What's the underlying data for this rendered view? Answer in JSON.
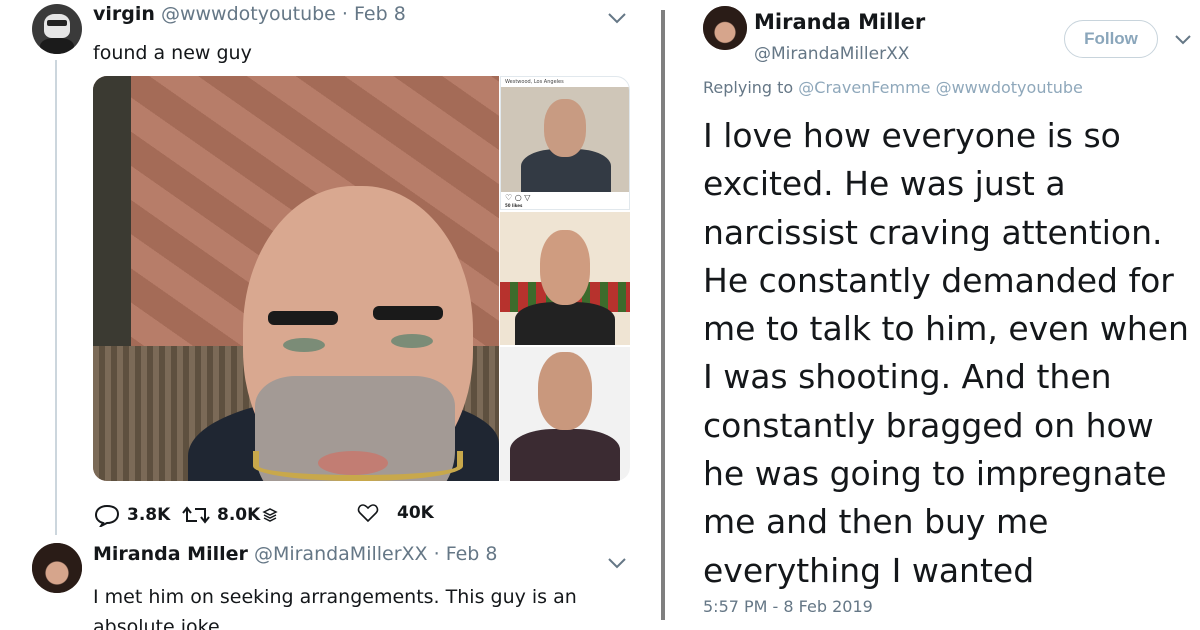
{
  "tweet1": {
    "name": "virgin",
    "handle": "@wwwdotyoutube",
    "date": "Feb 8",
    "text": "found a new guy",
    "image_a": {
      "location": "Westwood, Los Angeles",
      "likes": "50 likes"
    },
    "actions": {
      "replies": "3.8K",
      "retweets": "8.0K",
      "likes": "40K"
    }
  },
  "tweet2": {
    "name": "Miranda Miller",
    "handle": "@MirandaMillerXX",
    "date": "Feb 8",
    "text": "I met him on seeking arrangements. This guy is an absolute joke."
  },
  "detail": {
    "name": "Miranda Miller",
    "handle": "@MirandaMillerXX",
    "follow_label": "Follow",
    "replying_prefix": "Replying to",
    "replying_to": "@CravenFemme @wwwdotyoutube",
    "body": "I love how everyone is so excited. He was just a narcissist craving attention. He constantly demanded for me to talk to him, even when I was shooting. And then constantly bragged on how he was going to impregnate me and then buy me everything I wanted",
    "timestamp": "5:57 PM - 8 Feb 2019"
  },
  "colors": {
    "secondary_text": "#657786",
    "link_muted": "#8fa8bb",
    "divider": "#7f7f7f"
  }
}
